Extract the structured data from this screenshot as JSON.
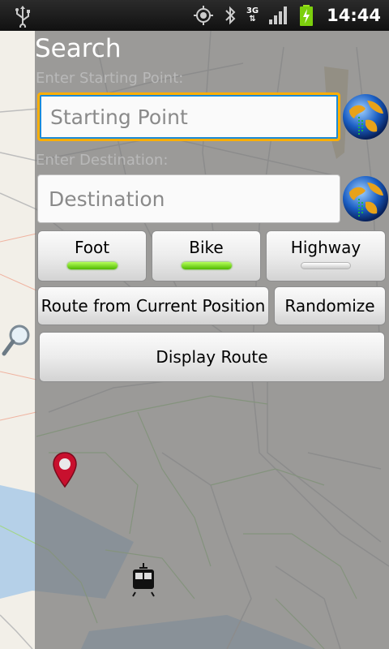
{
  "status_bar": {
    "network": "3G",
    "time": "14:44",
    "icons": [
      "usb-icon",
      "gps-icon",
      "bluetooth-icon",
      "network-3g-icon",
      "signal-icon",
      "battery-charging-icon"
    ]
  },
  "search": {
    "title": "Search",
    "start_label": "Enter Starting Point:",
    "start_placeholder": "Starting Point",
    "dest_label": "Enter Destination:",
    "dest_placeholder": "Destination"
  },
  "modes": [
    {
      "label": "Foot",
      "active": true
    },
    {
      "label": "Bike",
      "active": true
    },
    {
      "label": "Highway",
      "active": false
    }
  ],
  "actions": {
    "route_current": "Route from Current Position",
    "randomize": "Randomize",
    "display_route": "Display Route"
  },
  "colors": {
    "toggle_on": "#6ddc1a",
    "focus_border": "#ffae00",
    "marker": "#c8102e"
  }
}
